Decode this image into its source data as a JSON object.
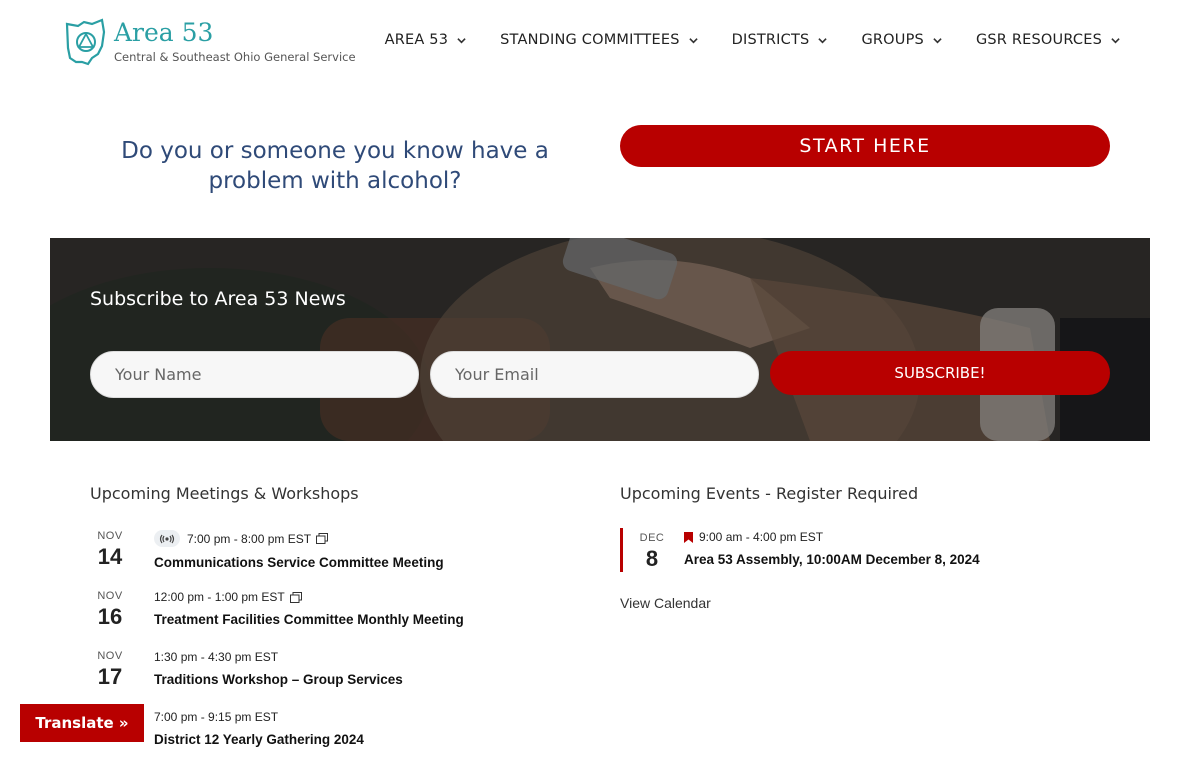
{
  "header": {
    "logo_title": "Area 53",
    "logo_subtitle": "Central & Southeast Ohio General Service",
    "nav": [
      {
        "label": "AREA 53"
      },
      {
        "label": "STANDING COMMITTEES"
      },
      {
        "label": "DISTRICTS"
      },
      {
        "label": "GROUPS"
      },
      {
        "label": "GSR RESOURCES"
      }
    ]
  },
  "hero": {
    "question": "Do you or someone you know have a problem with alcohol?",
    "start_label": "START HERE"
  },
  "subscribe": {
    "title": "Subscribe to Area 53 News",
    "name_placeholder": "Your Name",
    "email_placeholder": "Your Email",
    "button_label": "SUBSCRIBE!"
  },
  "meetings": {
    "title": "Upcoming Meetings & Workshops",
    "items": [
      {
        "month": "NOV",
        "day": "14",
        "time": "7:00 pm - 8:00 pm EST",
        "title": "Communications Service Committee Meeting"
      },
      {
        "month": "NOV",
        "day": "16",
        "time": "12:00 pm - 1:00 pm EST",
        "title": "Treatment Facilities Committee Monthly Meeting"
      },
      {
        "month": "NOV",
        "day": "17",
        "time": "1:30 pm - 4:30 pm EST",
        "title": "Traditions Workshop – Group Services"
      },
      {
        "month": "",
        "day": "",
        "time": "7:00 pm - 9:15 pm EST",
        "title": "District 12 Yearly Gathering 2024"
      }
    ]
  },
  "events": {
    "title": "Upcoming Events - Register Required",
    "items": [
      {
        "month": "DEC",
        "day": "8",
        "time": "9:00 am - 4:00 pm EST",
        "title": "Area 53 Assembly, 10:00AM December 8, 2024"
      }
    ],
    "view_calendar": "View Calendar"
  },
  "translate_label": "Translate »",
  "colors": {
    "accent": "#b80000",
    "teal": "#2a9fa4",
    "navy": "#2f4a78"
  }
}
